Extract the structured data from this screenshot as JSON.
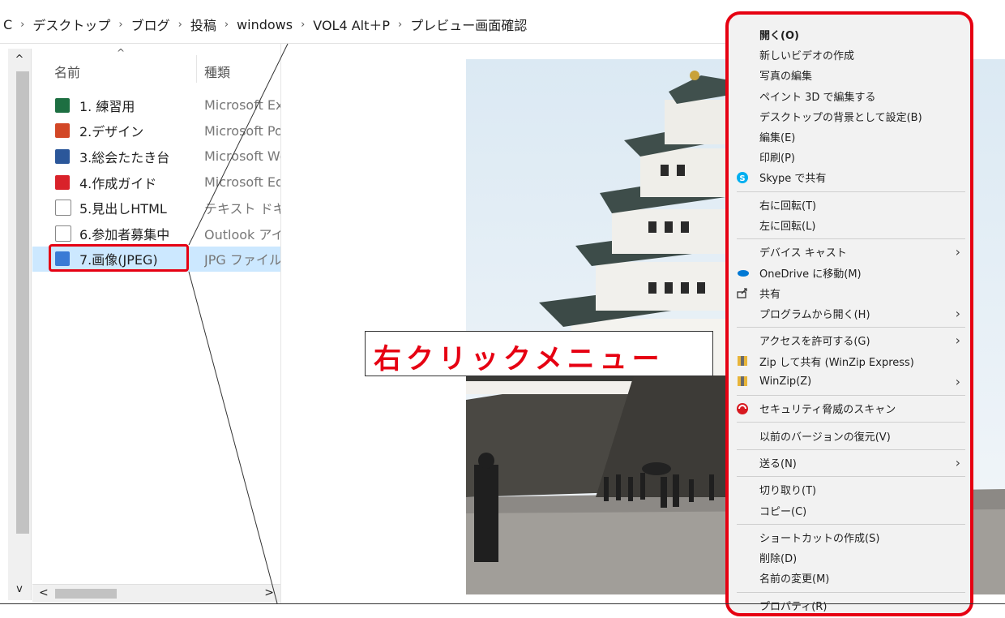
{
  "breadcrumb": [
    "C",
    "デスクトップ",
    "ブログ",
    "投稿",
    "windows",
    "VOL4 Alt＋P",
    "プレビュー画面確認"
  ],
  "breadcrumb_sep": "›",
  "columns": {
    "name": "名前",
    "type": "種類",
    "sort_indicator": "^"
  },
  "files": [
    {
      "name": "1. 練習用",
      "type": "Microsoft Ex",
      "icon": "excel-icon",
      "color": "#1d6f42"
    },
    {
      "name": "2.デザイン",
      "type": "Microsoft Po",
      "icon": "powerpoint-icon",
      "color": "#d24726"
    },
    {
      "name": "3.総会たたき台",
      "type": "Microsoft Wo",
      "icon": "word-icon",
      "color": "#2b579a"
    },
    {
      "name": "4.作成ガイド",
      "type": "Microsoft Ed",
      "icon": "pdf-icon",
      "color": "#d9222a"
    },
    {
      "name": "5.見出しHTML",
      "type": "テキスト ドキュ",
      "icon": "text-file-icon",
      "color": "#ffffff"
    },
    {
      "name": "6.参加者募集中",
      "type": "Outlook アイ",
      "icon": "mail-icon",
      "color": "#ffffff"
    },
    {
      "name": "7.画像(JPEG)",
      "type": "JPG ファイル",
      "icon": "image-file-icon",
      "color": "#3a7bd5",
      "selected": true
    }
  ],
  "scroll": {
    "up": "^",
    "down": "v",
    "left": "<",
    "right": ">"
  },
  "callout": {
    "text": "右クリックメニュー",
    "color": "#e60012"
  },
  "menu_items": [
    {
      "label": "開く(O)",
      "bold": true
    },
    {
      "label": "新しいビデオの作成"
    },
    {
      "label": "写真の編集"
    },
    {
      "label": "ペイント 3D で編集する"
    },
    {
      "label": "デスクトップの背景として設定(B)"
    },
    {
      "label": "編集(E)"
    },
    {
      "label": "印刷(P)"
    },
    {
      "label": "Skype で共有",
      "icon": "skype-icon"
    },
    {
      "sep": true
    },
    {
      "label": "右に回転(T)"
    },
    {
      "label": "左に回転(L)"
    },
    {
      "sep": true
    },
    {
      "label": "デバイス キャスト",
      "submenu": true
    },
    {
      "label": "OneDrive に移動(M)",
      "icon": "onedrive-icon"
    },
    {
      "label": "共有",
      "icon": "share-icon"
    },
    {
      "label": "プログラムから開く(H)",
      "submenu": true
    },
    {
      "sep": true
    },
    {
      "label": "アクセスを許可する(G)",
      "submenu": true
    },
    {
      "label": "Zip して共有 (WinZip Express)",
      "icon": "winzip-icon"
    },
    {
      "label": "WinZip(Z)",
      "icon": "winzip-icon",
      "submenu": true
    },
    {
      "sep": true
    },
    {
      "label": "セキュリティ脅威のスキャン",
      "icon": "trend-micro-icon"
    },
    {
      "sep": true
    },
    {
      "label": "以前のバージョンの復元(V)"
    },
    {
      "sep": true
    },
    {
      "label": "送る(N)",
      "submenu": true
    },
    {
      "sep": true
    },
    {
      "label": "切り取り(T)"
    },
    {
      "label": "コピー(C)"
    },
    {
      "sep": true
    },
    {
      "label": "ショートカットの作成(S)"
    },
    {
      "label": "削除(D)"
    },
    {
      "label": "名前の変更(M)"
    },
    {
      "sep": true
    },
    {
      "label": "プロパティ(R)"
    }
  ],
  "submenu_arrow": "›",
  "colors": {
    "highlight": "#e60012",
    "selection": "#cce8ff",
    "menu_bg": "#f2f2f2"
  }
}
